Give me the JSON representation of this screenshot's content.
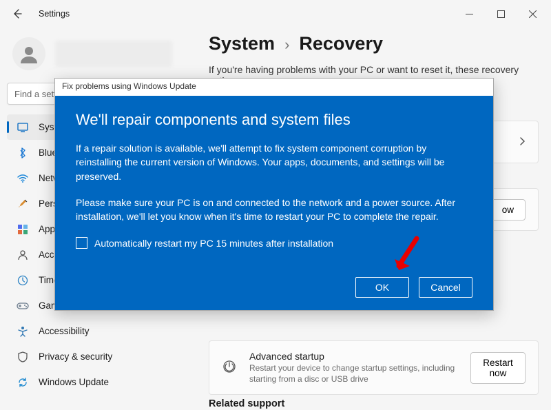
{
  "window": {
    "title": "Settings"
  },
  "search": {
    "placeholder": "Find a setting"
  },
  "nav": {
    "items": [
      {
        "label": "System"
      },
      {
        "label": "Bluetooth & devices"
      },
      {
        "label": "Network & internet"
      },
      {
        "label": "Personalization"
      },
      {
        "label": "Apps"
      },
      {
        "label": "Accounts"
      },
      {
        "label": "Time & language"
      },
      {
        "label": "Gaming"
      },
      {
        "label": "Accessibility"
      },
      {
        "label": "Privacy & security"
      },
      {
        "label": "Windows Update"
      }
    ]
  },
  "breadcrumb": {
    "parent": "System",
    "sep": "›",
    "current": "Recovery"
  },
  "subtitle": "If you're having problems with your PC or want to reset it, these recovery options",
  "cards": {
    "advanced": {
      "title": "Advanced startup",
      "desc": "Restart your device to change startup settings, including starting from a disc or USB drive",
      "button": "Restart now"
    },
    "partial_button": "ow"
  },
  "related_header": "Related support",
  "dialog": {
    "titlebar": "Fix problems using Windows Update",
    "heading": "We'll repair components and system files",
    "p1": "If a repair solution is available, we'll attempt to fix system component corruption by reinstalling the current version of Windows. Your apps, documents, and settings will be preserved.",
    "p2": "Please make sure your PC is on and connected to the network and a power source. After installation, we'll let you know when it's time to restart your PC to complete the repair.",
    "checkbox_label": "Automatically restart my PC 15 minutes after installation",
    "ok": "OK",
    "cancel": "Cancel"
  }
}
